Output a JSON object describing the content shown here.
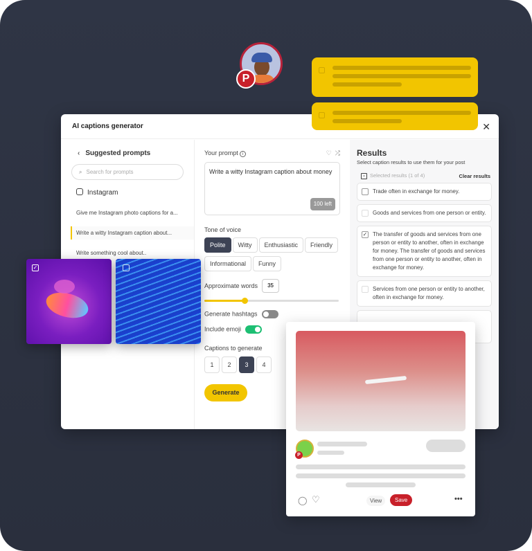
{
  "dialog": {
    "title": "AI captions generator",
    "close_icon": "close-icon"
  },
  "left": {
    "back_label": "Suggested prompts",
    "search_placeholder": "Search for prompts",
    "category": "Instagram",
    "prompts": [
      "Give me Instagram photo captions for a...",
      "Write a witty Instagram caption about...",
      "Write something cool about.."
    ],
    "active_index": 1
  },
  "mid": {
    "prompt_label": "Your prompt",
    "prompt_value": "Write a witty Instagram caption about money",
    "chars_left": "100 left",
    "tone_label": "Tone of voice",
    "tones": [
      "Polite",
      "Witty",
      "Enthusiastic",
      "Friendly",
      "Informational",
      "Funny"
    ],
    "tone_selected": "Polite",
    "words_label": "Approximate words",
    "words_value": "35",
    "words_slider_fraction": 0.3,
    "hashtags_label": "Generate hashtags",
    "hashtags_on": false,
    "emoji_label": "Include emoji",
    "emoji_on": true,
    "captions_label": "Captions to generate",
    "caption_counts": [
      "1",
      "2",
      "3",
      "4"
    ],
    "caption_selected": "3",
    "generate_label": "Generate"
  },
  "results": {
    "title": "Results",
    "subtitle": "Select caption results to use them for your post",
    "selected_label": "Selected results (1 of 4)",
    "clear_label": "Clear results",
    "items": [
      {
        "text": "Trade often in exchange for money.",
        "checked": false
      },
      {
        "text": "Goods and services from one person or entity.",
        "checked": false
      },
      {
        "text": "The transfer of goods and services from one person or entity to another, often in exchange for money. The transfer of goods and services from one person or entity to another, often in exchange for money.",
        "checked": true
      },
      {
        "text": "Services from one person or entity to another, often in exchange for money.",
        "checked": false
      }
    ]
  },
  "post": {
    "view_label": "View",
    "save_label": "Save"
  },
  "colors": {
    "accent": "#f2c500",
    "dark": "#3d4355",
    "pinterest": "#c8202a",
    "toggle_on": "#1dbf73"
  }
}
